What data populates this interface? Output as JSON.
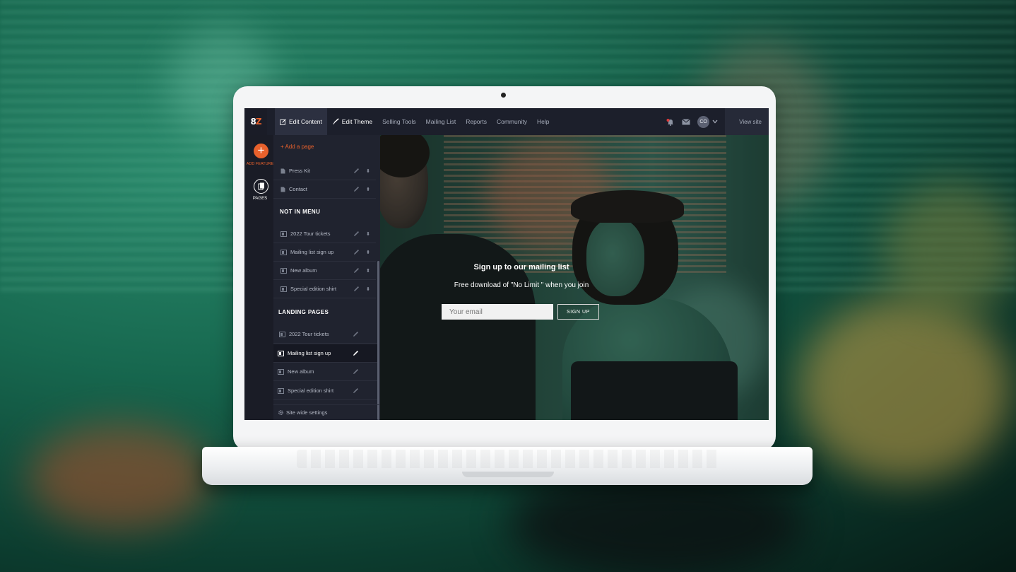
{
  "topbar": {
    "logo_text": "8",
    "logo_accent": "Z",
    "nav": [
      {
        "label": "Edit Content",
        "icon": "edit-square-icon"
      },
      {
        "label": "Edit Theme",
        "icon": "brush-icon"
      },
      {
        "label": "Selling Tools"
      },
      {
        "label": "Mailing List"
      },
      {
        "label": "Reports"
      },
      {
        "label": "Community"
      },
      {
        "label": "Help"
      }
    ],
    "avatar_initials": "CO",
    "view_site": "View site"
  },
  "rail": {
    "add_label": "ADD FEATURE",
    "pages_label": "PAGES"
  },
  "panel": {
    "add_page": "+ Add a page",
    "menu_pages": [
      "Press Kit",
      "Contact"
    ],
    "not_in_menu_heading": "NOT IN MENU",
    "not_in_menu": [
      "2022 Tour tickets",
      "Mailing list sign up",
      "New album",
      "Special edition shirt"
    ],
    "landing_heading": "LANDING PAGES",
    "landing": [
      "2022 Tour tickets",
      "Mailing list sign up",
      "New album",
      "Special edition shirt"
    ],
    "landing_active": "Mailing list sign up",
    "site_settings": "Site wide settings"
  },
  "hero": {
    "title": "Sign up to our mailing list",
    "subtitle": "Free download of \"No Limit \" when you join",
    "email_placeholder": "Your email",
    "signup_label": "SIGN UP"
  },
  "colors": {
    "accent": "#e8612c",
    "topbar": "#1c1f2b",
    "panel": "#20232f"
  }
}
